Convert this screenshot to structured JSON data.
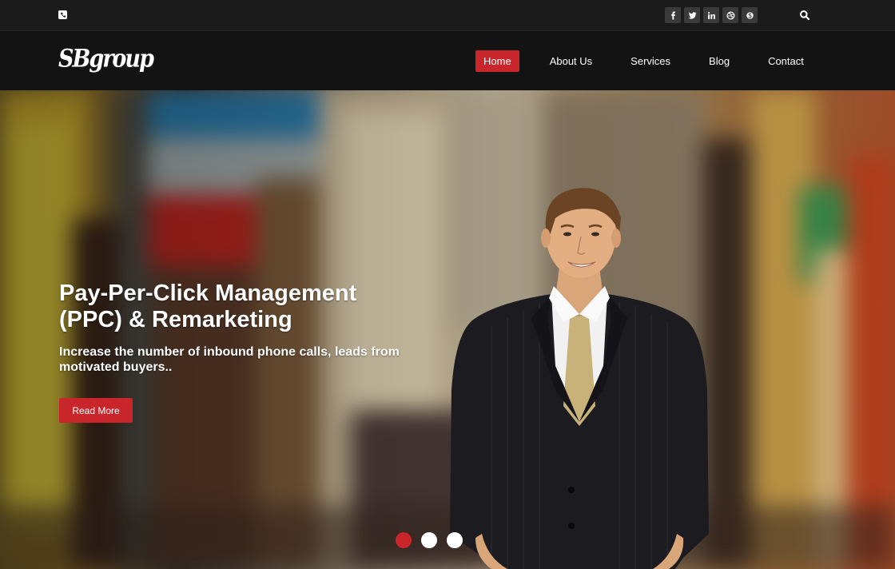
{
  "topbar": {
    "phone_icon": "phone-icon",
    "socials": [
      {
        "name": "facebook-icon",
        "glyph": "f"
      },
      {
        "name": "twitter-icon",
        "glyph": "t"
      },
      {
        "name": "linkedin-icon",
        "glyph": "in"
      },
      {
        "name": "dribbble-icon",
        "glyph": "d"
      },
      {
        "name": "skype-icon",
        "glyph": "s"
      }
    ],
    "search_icon": "search-icon"
  },
  "nav": {
    "logo": "SBgroup",
    "items": [
      {
        "label": "Home",
        "active": true
      },
      {
        "label": "About Us",
        "active": false
      },
      {
        "label": "Services",
        "active": false
      },
      {
        "label": "Blog",
        "active": false
      },
      {
        "label": "Contact",
        "active": false
      }
    ]
  },
  "hero": {
    "title_line1": "Pay-Per-Click Management",
    "title_line2": "(PPC) & Remarketing",
    "subtitle_line1": "Increase the number of inbound phone calls, leads from",
    "subtitle_line2": "motivated buyers..",
    "button_label": "Read More",
    "slides": 3,
    "active_slide": 0
  },
  "colors": {
    "accent": "#c9262c",
    "topbar_bg": "#1b1b1b",
    "navbar_bg": "#131313"
  }
}
